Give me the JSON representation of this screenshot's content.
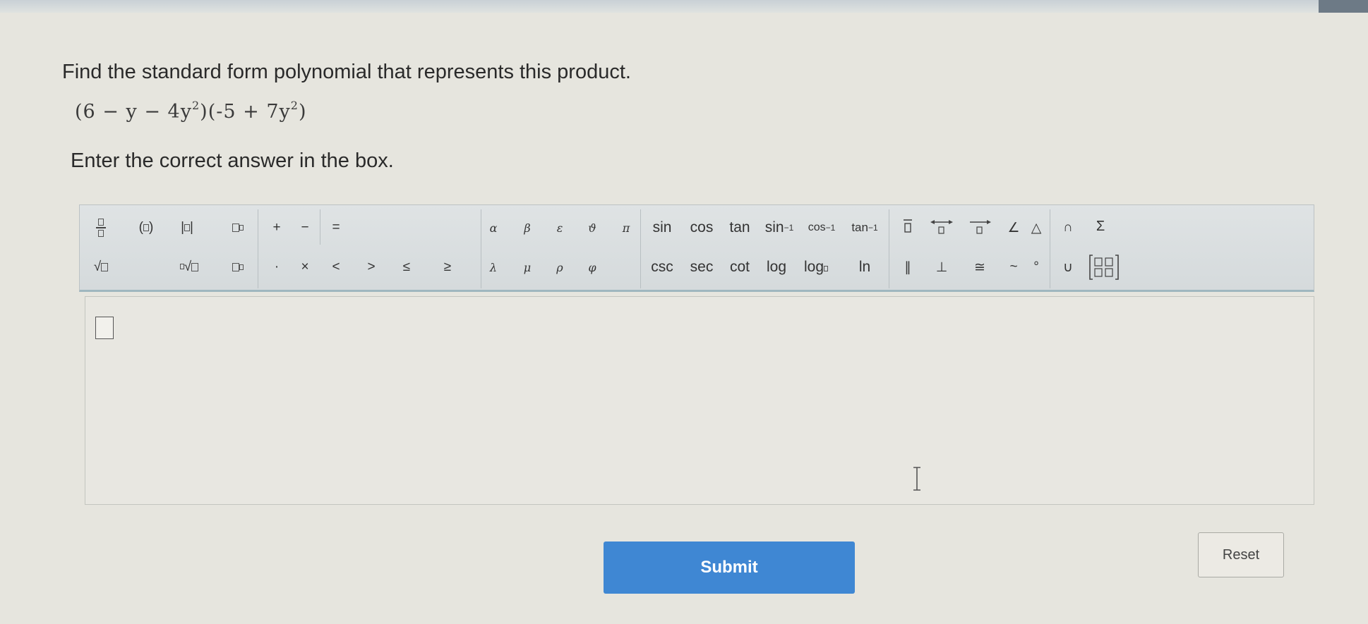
{
  "question": {
    "prompt": "Find the standard form polynomial that represents this product.",
    "expression_part1": "(6 − y − 4y",
    "expression_exp1": "2",
    "expression_part2": ")(-5 + 7y",
    "expression_exp2": "2",
    "expression_part3": ")",
    "instruction": "Enter the correct answer in the box."
  },
  "toolbar": {
    "row1": {
      "plus": "+",
      "minus": "−",
      "equals": "=",
      "alpha": "α",
      "beta": "β",
      "epsilon": "ε",
      "theta": "ϑ",
      "pi": "π",
      "sin": "sin",
      "cos": "cos",
      "tan": "tan",
      "arcsin": "sin",
      "arccos": "cos",
      "arctan": "tan",
      "inv_exp": "−1",
      "angle": "∠",
      "triangle": "△",
      "intersect": "∩",
      "sigma": "Σ"
    },
    "row2": {
      "dot": "·",
      "times": "×",
      "lt": "<",
      "gt": ">",
      "le": "≤",
      "ge": "≥",
      "lambda": "λ",
      "mu": "μ",
      "rho": "ρ",
      "phi": "φ",
      "csc": "csc",
      "sec": "sec",
      "cot": "cot",
      "log": "log",
      "logn": "log",
      "ln": "ln",
      "parallel": "∥",
      "perp": "⊥",
      "congruent": "≅",
      "similar": "~",
      "degree": "°",
      "union": "∪"
    }
  },
  "buttons": {
    "submit": "Submit",
    "reset": "Reset"
  },
  "colors": {
    "submit_bg": "#3f87d3",
    "toolbar_bg": "#dfe3e4",
    "page_bg": "#e6e5de"
  }
}
